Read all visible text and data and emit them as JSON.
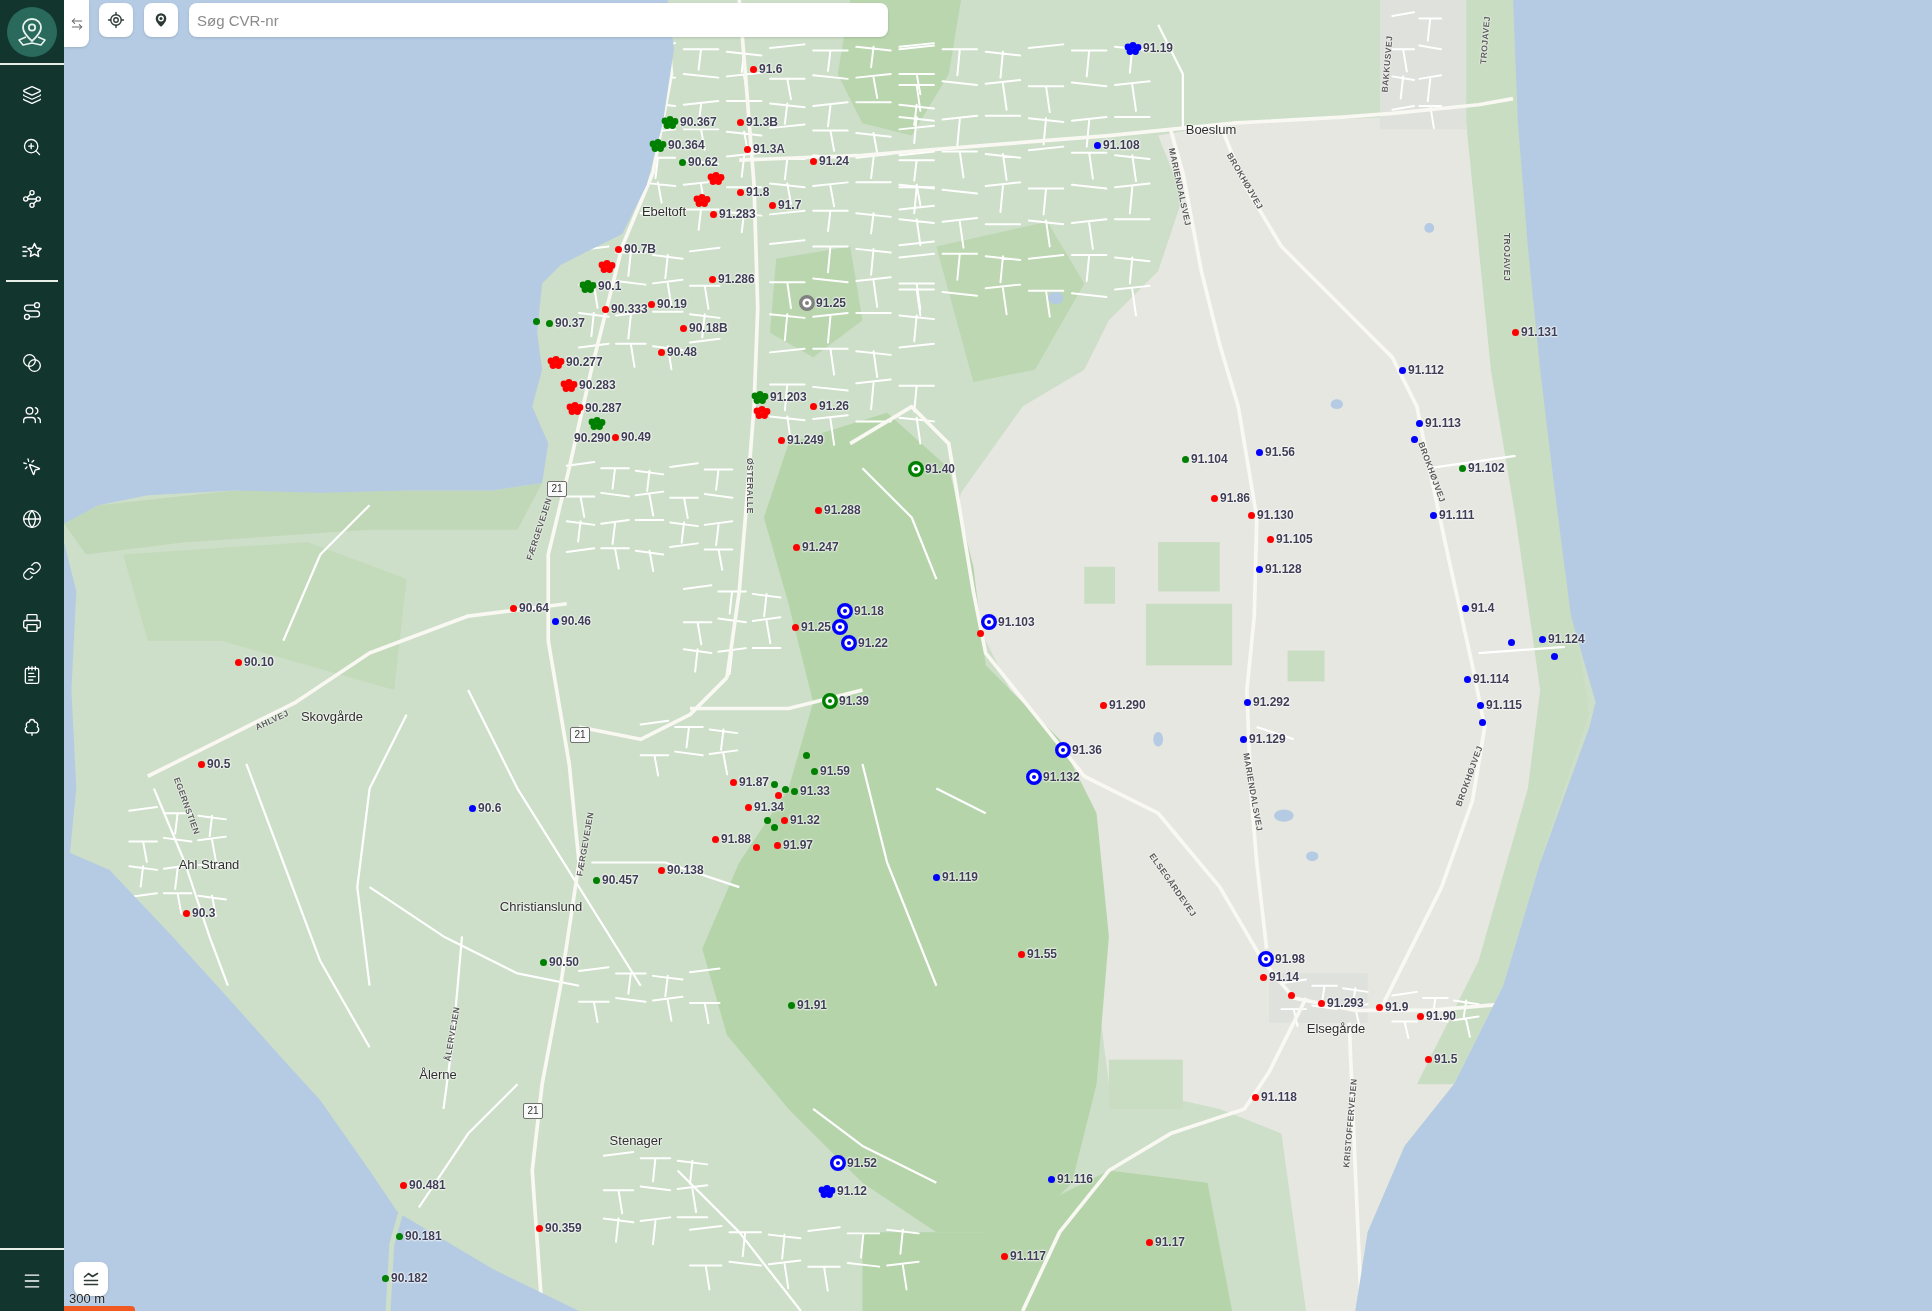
{
  "toolbar": {
    "search": {
      "placeholder": "Søg CVR-nr"
    }
  },
  "map": {
    "places": [
      "Boeslum",
      "Ebeltoft",
      "Skovgårde",
      "Ahl Strand",
      "Christianslund",
      "Elsegårde",
      "Ålerne",
      "Stenager"
    ],
    "road_labels": [
      "TROJAVEJ",
      "BAKKUSVEJ",
      "BROKHØJVEJ",
      "MARIENDALSVEJ",
      "TROJAVEJ",
      "BROKHØJVEJ",
      "ØSTERALLE",
      "FÆRGEVEJEN",
      "AHLVEJ",
      "BROKHØJVEJ",
      "MARIENDALSVEJ",
      "EGERNSTIEN",
      "FÆRGEVEJEN",
      "ELSEGÅRDEVEJ",
      "ÅLERVEJEN",
      "KRISTOFFERVEJEN"
    ],
    "route_shields": [
      "21",
      "21",
      "21"
    ],
    "markers": [
      {
        "label": "91.19",
        "kind": "cluster",
        "color": "#0000ff"
      },
      {
        "label": "91.6",
        "kind": "dot",
        "color": "#ff0000"
      },
      {
        "label": "90.367",
        "kind": "cluster",
        "color": "#008000"
      },
      {
        "label": "91.3B",
        "kind": "dot",
        "color": "#ff0000"
      },
      {
        "label": "90.364",
        "kind": "cluster",
        "color": "#008000"
      },
      {
        "label": "91.3A",
        "kind": "dot",
        "color": "#ff0000"
      },
      {
        "label": "91.108",
        "kind": "dot",
        "color": "#0000ff"
      },
      {
        "label": "90.62",
        "kind": "dot",
        "color": "#008000"
      },
      {
        "label": "91.24",
        "kind": "dot",
        "color": "#ff0000"
      },
      {
        "kind": "cluster",
        "color": "#ff0000"
      },
      {
        "kind": "cluster",
        "color": "#ff0000"
      },
      {
        "label": "91.8",
        "kind": "dot",
        "color": "#ff0000"
      },
      {
        "label": "91.7",
        "kind": "dot",
        "color": "#ff0000"
      },
      {
        "label": "91.283",
        "kind": "dot",
        "color": "#ff0000"
      },
      {
        "label": "90.7B",
        "kind": "dot",
        "color": "#ff0000"
      },
      {
        "kind": "cluster",
        "color": "#ff0000"
      },
      {
        "label": "90.1",
        "kind": "cluster",
        "color": "#008000"
      },
      {
        "label": "91.286",
        "kind": "dot",
        "color": "#ff0000"
      },
      {
        "label": "90.333",
        "kind": "dot",
        "color": "#ff0000"
      },
      {
        "label": "90.19",
        "kind": "dot",
        "color": "#ff0000"
      },
      {
        "label": "91.25",
        "kind": "ring",
        "color": "#808080"
      },
      {
        "kind": "dot",
        "color": "#008000"
      },
      {
        "label": "90.37",
        "kind": "dot",
        "color": "#008000"
      },
      {
        "label": "90.18B",
        "kind": "dot",
        "color": "#ff0000"
      },
      {
        "label": "91.131",
        "kind": "dot",
        "color": "#ff0000"
      },
      {
        "label": "90.48",
        "kind": "dot",
        "color": "#ff0000"
      },
      {
        "label": "90.277",
        "kind": "cluster",
        "color": "#ff0000"
      },
      {
        "label": "91.112",
        "kind": "dot",
        "color": "#0000ff"
      },
      {
        "label": "90.283",
        "kind": "cluster",
        "color": "#ff0000"
      },
      {
        "label": "91.203",
        "kind": "cluster",
        "color": "#008000"
      },
      {
        "label": "90.287",
        "kind": "cluster",
        "color": "#ff0000"
      },
      {
        "kind": "cluster",
        "color": "#ff0000"
      },
      {
        "label": "91.26",
        "kind": "dot",
        "color": "#ff0000"
      },
      {
        "label": "90.290",
        "kind": "cluster",
        "color": "#008000"
      },
      {
        "label": "91.113",
        "kind": "dot",
        "color": "#0000ff"
      },
      {
        "label": "90.49",
        "kind": "dot",
        "color": "#ff0000"
      },
      {
        "label": "91.249",
        "kind": "dot",
        "color": "#ff0000"
      },
      {
        "kind": "dot",
        "color": "#0000ff"
      },
      {
        "label": "91.104",
        "kind": "dot",
        "color": "#008000"
      },
      {
        "label": "91.56",
        "kind": "dot",
        "color": "#0000ff"
      },
      {
        "label": "91.40",
        "kind": "ring",
        "color": "#008000"
      },
      {
        "label": "91.102",
        "kind": "dot",
        "color": "#008000"
      },
      {
        "label": "91.86",
        "kind": "dot",
        "color": "#ff0000"
      },
      {
        "label": "91.288",
        "kind": "dot",
        "color": "#ff0000"
      },
      {
        "label": "91.130",
        "kind": "dot",
        "color": "#ff0000"
      },
      {
        "label": "91.111",
        "kind": "dot",
        "color": "#0000ff"
      },
      {
        "label": "91.247",
        "kind": "dot",
        "color": "#ff0000"
      },
      {
        "label": "91.105",
        "kind": "dot",
        "color": "#ff0000"
      },
      {
        "label": "91.128",
        "kind": "dot",
        "color": "#0000ff"
      },
      {
        "label": "90.64",
        "kind": "dot",
        "color": "#ff0000"
      },
      {
        "label": "91.18",
        "kind": "ring",
        "color": "#0000ff"
      },
      {
        "label": "91.4",
        "kind": "dot",
        "color": "#0000ff"
      },
      {
        "label": "90.46",
        "kind": "dot",
        "color": "#0000ff"
      },
      {
        "label": "91.25",
        "kind": "dot",
        "color": "#ff0000"
      },
      {
        "kind": "ring",
        "color": "#0000ff"
      },
      {
        "label": "91.103",
        "kind": "ring",
        "color": "#0000ff"
      },
      {
        "kind": "dot",
        "color": "#ff0000"
      },
      {
        "label": "91.22",
        "kind": "ring",
        "color": "#0000ff"
      },
      {
        "kind": "dot",
        "color": "#0000ff"
      },
      {
        "label": "91.124",
        "kind": "dot",
        "color": "#0000ff"
      },
      {
        "label": "90.10",
        "kind": "dot",
        "color": "#ff0000"
      },
      {
        "kind": "dot",
        "color": "#0000ff"
      },
      {
        "label": "91.114",
        "kind": "dot",
        "color": "#0000ff"
      },
      {
        "label": "91.39",
        "kind": "ring",
        "color": "#008000"
      },
      {
        "label": "91.290",
        "kind": "dot",
        "color": "#ff0000"
      },
      {
        "label": "91.292",
        "kind": "dot",
        "color": "#0000ff"
      },
      {
        "label": "91.115",
        "kind": "dot",
        "color": "#0000ff"
      },
      {
        "kind": "dot",
        "color": "#0000ff"
      },
      {
        "label": "91.129",
        "kind": "dot",
        "color": "#0000ff"
      },
      {
        "kind": "dot",
        "color": "#008000"
      },
      {
        "label": "91.36",
        "kind": "ring",
        "color": "#0000ff"
      },
      {
        "label": "90.5",
        "kind": "dot",
        "color": "#ff0000"
      },
      {
        "label": "91.59",
        "kind": "dot",
        "color": "#008000"
      },
      {
        "label": "91.87",
        "kind": "dot",
        "color": "#ff0000"
      },
      {
        "kind": "dot",
        "color": "#008000"
      },
      {
        "label": "91.132",
        "kind": "ring",
        "color": "#0000ff"
      },
      {
        "kind": "dot",
        "color": "#ff0000"
      },
      {
        "kind": "dot",
        "color": "#008000"
      },
      {
        "label": "91.33",
        "kind": "dot",
        "color": "#008000"
      },
      {
        "label": "90.6",
        "kind": "dot",
        "color": "#0000ff"
      },
      {
        "label": "91.34",
        "kind": "dot",
        "color": "#ff0000"
      },
      {
        "kind": "dot",
        "color": "#008000"
      },
      {
        "kind": "dot",
        "color": "#008000"
      },
      {
        "label": "91.32",
        "kind": "dot",
        "color": "#ff0000"
      },
      {
        "label": "91.88",
        "kind": "dot",
        "color": "#ff0000"
      },
      {
        "kind": "dot",
        "color": "#ff0000"
      },
      {
        "label": "91.97",
        "kind": "dot",
        "color": "#ff0000"
      },
      {
        "label": "90.138",
        "kind": "dot",
        "color": "#ff0000"
      },
      {
        "label": "90.457",
        "kind": "dot",
        "color": "#008000"
      },
      {
        "label": "91.119",
        "kind": "dot",
        "color": "#0000ff"
      },
      {
        "label": "90.3",
        "kind": "dot",
        "color": "#ff0000"
      },
      {
        "label": "90.50",
        "kind": "dot",
        "color": "#008000"
      },
      {
        "label": "91.55",
        "kind": "dot",
        "color": "#ff0000"
      },
      {
        "label": "91.98",
        "kind": "ring",
        "color": "#0000ff"
      },
      {
        "label": "91.14",
        "kind": "dot",
        "color": "#ff0000"
      },
      {
        "kind": "dot",
        "color": "#ff0000"
      },
      {
        "label": "91.91",
        "kind": "dot",
        "color": "#008000"
      },
      {
        "label": "91.293",
        "kind": "dot",
        "color": "#ff0000"
      },
      {
        "label": "91.9",
        "kind": "dot",
        "color": "#ff0000"
      },
      {
        "label": "91.90",
        "kind": "dot",
        "color": "#ff0000"
      },
      {
        "label": "91.5",
        "kind": "dot",
        "color": "#ff0000"
      },
      {
        "label": "91.118",
        "kind": "dot",
        "color": "#ff0000"
      },
      {
        "label": "91.52",
        "kind": "ring",
        "color": "#0000ff"
      },
      {
        "label": "90.481",
        "kind": "dot",
        "color": "#ff0000"
      },
      {
        "label": "91.116",
        "kind": "dot",
        "color": "#0000ff"
      },
      {
        "label": "91.12",
        "kind": "cluster",
        "color": "#0000ff"
      },
      {
        "label": "90.181",
        "kind": "dot",
        "color": "#008000"
      },
      {
        "label": "90.359",
        "kind": "dot",
        "color": "#ff0000"
      },
      {
        "label": "91.17",
        "kind": "dot",
        "color": "#ff0000"
      },
      {
        "label": "91.117",
        "kind": "dot",
        "color": "#ff0000"
      },
      {
        "label": "90.182",
        "kind": "dot",
        "color": "#008000"
      }
    ],
    "scale": "300 m"
  }
}
